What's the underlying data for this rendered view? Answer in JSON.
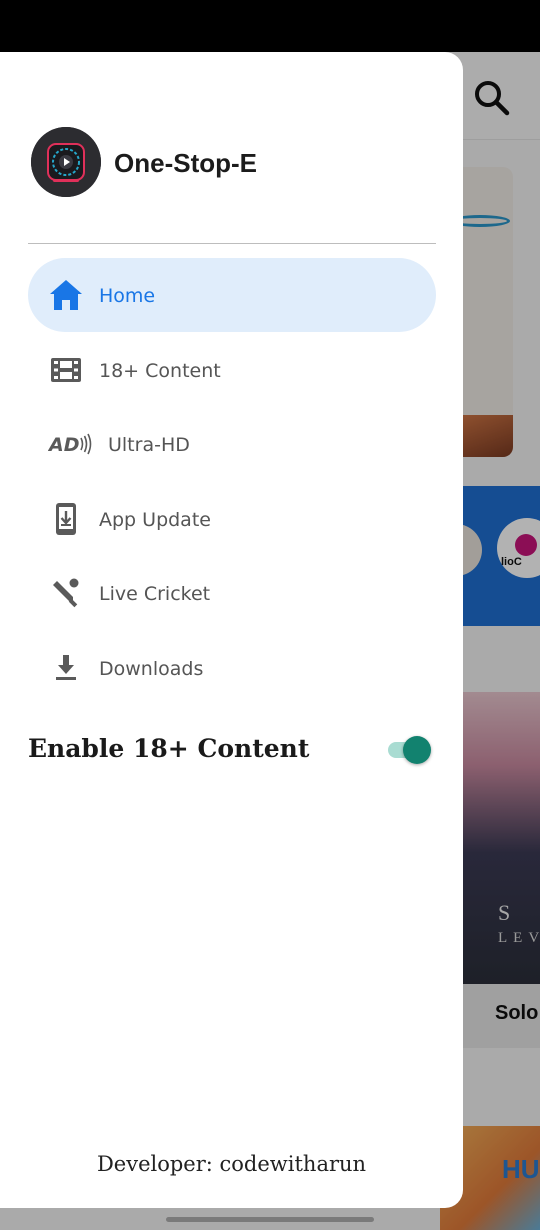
{
  "app": {
    "name": "One-Stop-E"
  },
  "nav": {
    "items": [
      {
        "label": "Home",
        "icon": "home-icon",
        "active": true
      },
      {
        "label": "18+ Content",
        "icon": "film-icon",
        "active": false
      },
      {
        "label": "Ultra-HD",
        "icon": "audio-description-icon",
        "active": false
      },
      {
        "label": "App Update",
        "icon": "phone-download-icon",
        "active": false
      },
      {
        "label": "Live Cricket",
        "icon": "cricket-icon",
        "active": false
      },
      {
        "label": "Downloads",
        "icon": "download-icon",
        "active": false
      }
    ]
  },
  "settings": {
    "enable_adult_label": "Enable 18+ Content",
    "enable_adult_on": true
  },
  "footer": {
    "developer": "Developer: codewitharun"
  },
  "background": {
    "channel_label": "lioC",
    "poster_title": "Solo",
    "poster_text1": "S",
    "poster_text2": "LEV",
    "poster2_text": "HU"
  },
  "colors": {
    "accent": "#1976e6",
    "active_bg": "#e0edfb",
    "toggle_on": "#12826f",
    "toggle_track": "#a9dcd2"
  }
}
